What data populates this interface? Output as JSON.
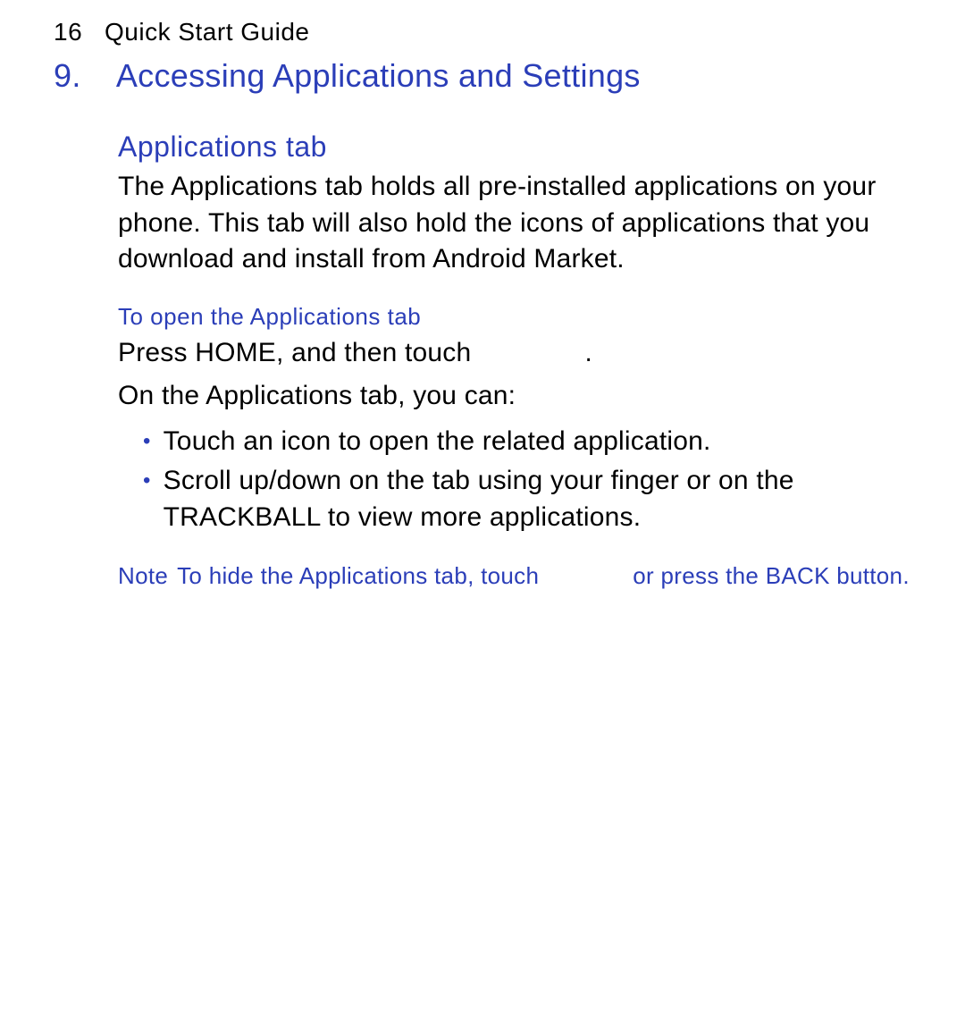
{
  "header": {
    "page_number": "16",
    "doc_title": "Quick Start Guide"
  },
  "section": {
    "number": "9.",
    "title": "Accessing Applications and Settings"
  },
  "subsection": {
    "title": "Applications tab",
    "body": "The Applications tab holds all pre-installed applications on your phone. This tab will also hold the icons of applications that you download and install from Android Market."
  },
  "instruction": {
    "heading": "To open the Applications tab",
    "line1_pre": "Press HOME, and then touch",
    "line1_post": ".",
    "line2": "On the Applications tab, you can:"
  },
  "bullets": [
    "Touch an icon to open the related application.",
    "Scroll up/down on the tab using your finger or on the TRACKBALL to view more applications."
  ],
  "note": {
    "label": "Note",
    "text_pre": "To hide the Applications tab, touch",
    "text_post": "or press the BACK button."
  }
}
